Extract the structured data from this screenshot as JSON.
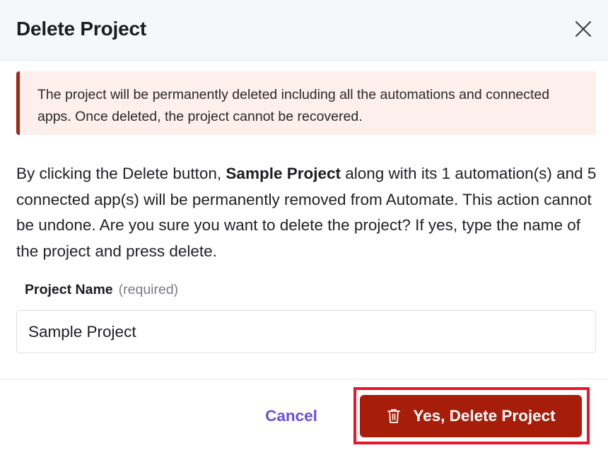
{
  "dialog": {
    "title": "Delete Project",
    "close_icon": "close-icon"
  },
  "alert": {
    "text": "The project will be permanently deleted including all the automations and connected apps. Once deleted, the project cannot be recovered.",
    "accent_color": "#a32712",
    "background_color": "#fdefec"
  },
  "description": {
    "prefix": "By clicking the Delete button, ",
    "project_name": "Sample Project",
    "suffix": " along with its 1 automation(s) and 5 connected app(s) will be permanently removed from Automate. This action cannot be undone. Are you sure you want to delete the project? If yes, type the name of the project and press delete."
  },
  "form": {
    "label": "Project Name",
    "required_hint": "(required)",
    "value": "Sample Project"
  },
  "footer": {
    "cancel_label": "Cancel",
    "delete_label": "Yes, Delete Project",
    "delete_icon": "trash-icon",
    "cancel_color": "#6a4fd8",
    "delete_color": "#a61e0a",
    "highlight_color": "#e8152d"
  }
}
